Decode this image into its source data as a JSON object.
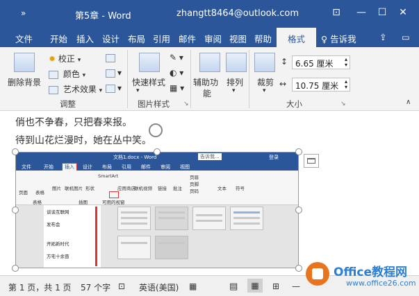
{
  "titlebar": {
    "save_icon": "»",
    "title": "第5章 - Word",
    "user": "zhangtt8464@outlook.com",
    "ribbon_display_icon": "⊡",
    "minimize_icon": "—",
    "maximize_icon": "☐",
    "close_icon": "✕"
  },
  "menu": {
    "items": [
      "文件",
      "开始",
      "插入",
      "设计",
      "布局",
      "引用",
      "邮件",
      "审阅",
      "视图",
      "帮助"
    ],
    "active": "格式",
    "tell_me": "♀ 告诉我",
    "share_icon": "⇪",
    "comment_icon": "▭"
  },
  "ribbon": {
    "remove_bg": "删除背景",
    "correct": "校正",
    "color": "颜色",
    "art_effect": "艺术效果",
    "adjust_group": "调整",
    "quick_styles": "快速样式",
    "picture_styles_group": "图片样式",
    "alt_text": [
      "辅助功",
      "能"
    ],
    "arrange": "排列",
    "crop": "裁剪",
    "height": "6.65 厘米",
    "width": "10.75 厘米",
    "size_group": "大小"
  },
  "document": {
    "line1": "俏也不争春，只把春来报。",
    "line2": "待到山花烂漫时，她在丛中笑。"
  },
  "inner_screenshot": {
    "title": "文档1.docx - Word",
    "login": "登录",
    "search": "告诉我...",
    "menu": [
      "文件",
      "开始",
      "插入",
      "设计",
      "布局",
      "引用",
      "邮件",
      "审阅",
      "视图"
    ],
    "ribbon_items": [
      "页面",
      "表格",
      "图片",
      "联机图片",
      "形状",
      "SmartArt",
      "应用商店",
      "联机视频",
      "链接",
      "批注",
      "页眉",
      "页脚",
      "页码",
      "文本",
      "符号"
    ],
    "group_labels": [
      "表格",
      "插图",
      "可用的视窗"
    ],
    "doc_lines": [
      "谈谈互联网",
      "发布会",
      "开拓新时代",
      "方宅十余亩"
    ]
  },
  "statusbar": {
    "page": "第 1 页，共 1 页",
    "words": "57 个字",
    "proof_icon": "⊡",
    "language": "英语(美国)",
    "track_icon": "▦"
  },
  "watermark": {
    "text": "Office教程网",
    "url": "www.office26.com"
  }
}
